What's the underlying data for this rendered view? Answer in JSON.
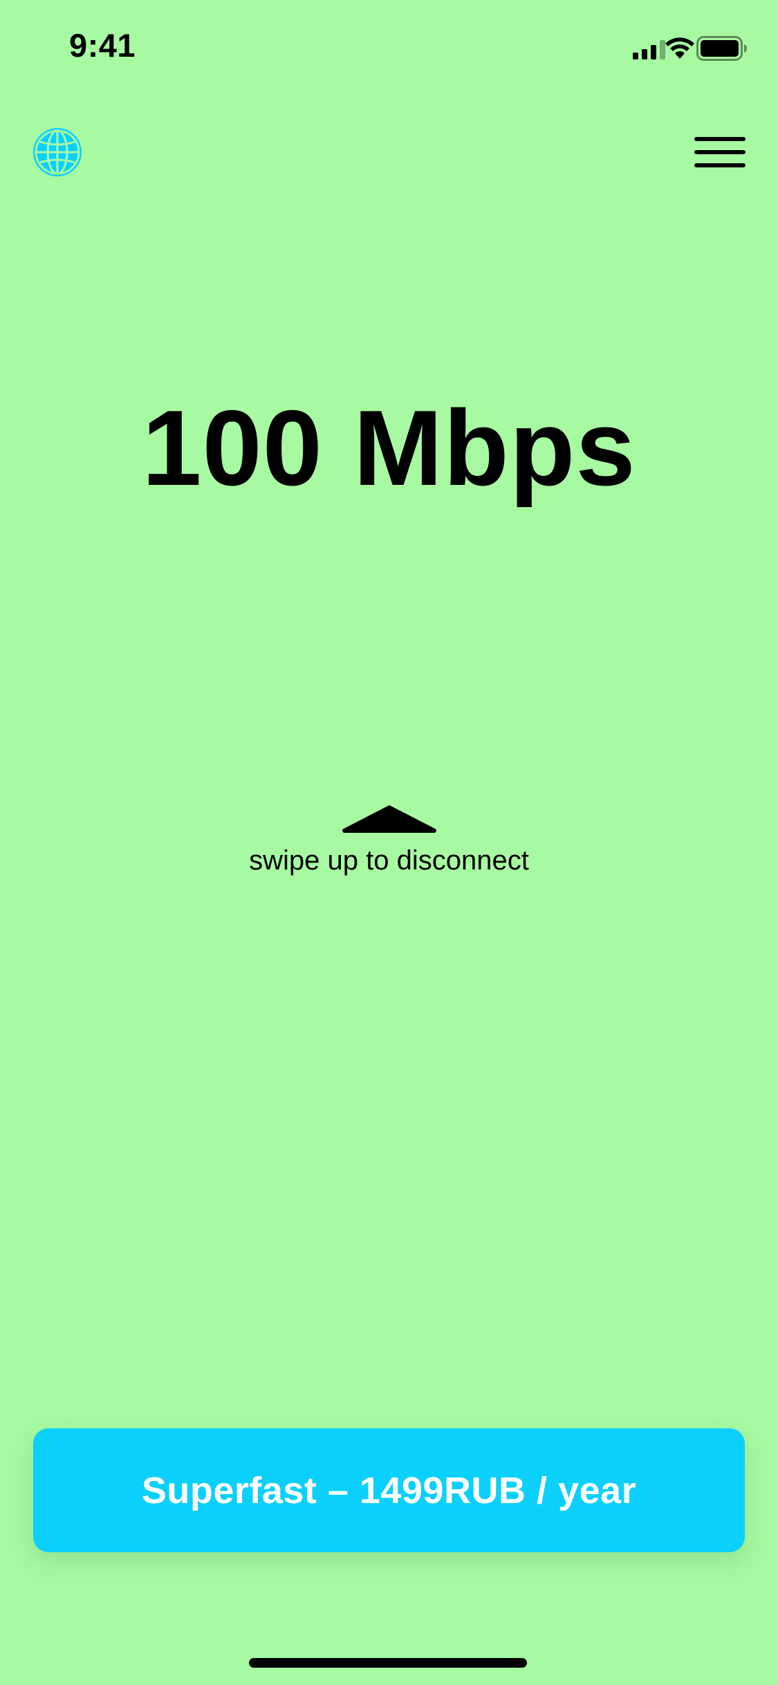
{
  "status_bar": {
    "time": "9:41",
    "icons": [
      "cellular-signal-icon",
      "wifi-icon",
      "battery-icon"
    ]
  },
  "header": {
    "left_icon": "globe-icon",
    "right_icon": "hamburger-menu-icon"
  },
  "speed": {
    "value": "100 Mbps"
  },
  "swipe": {
    "icon": "arrow-up-icon",
    "label": "swipe up to disconnect"
  },
  "plan_button": {
    "label": "Superfast – 1499RUB / year"
  },
  "colors": {
    "background": "#a8faa2",
    "accent": "#0ad0fb",
    "text": "#000000",
    "button_text": "#ffffff"
  }
}
